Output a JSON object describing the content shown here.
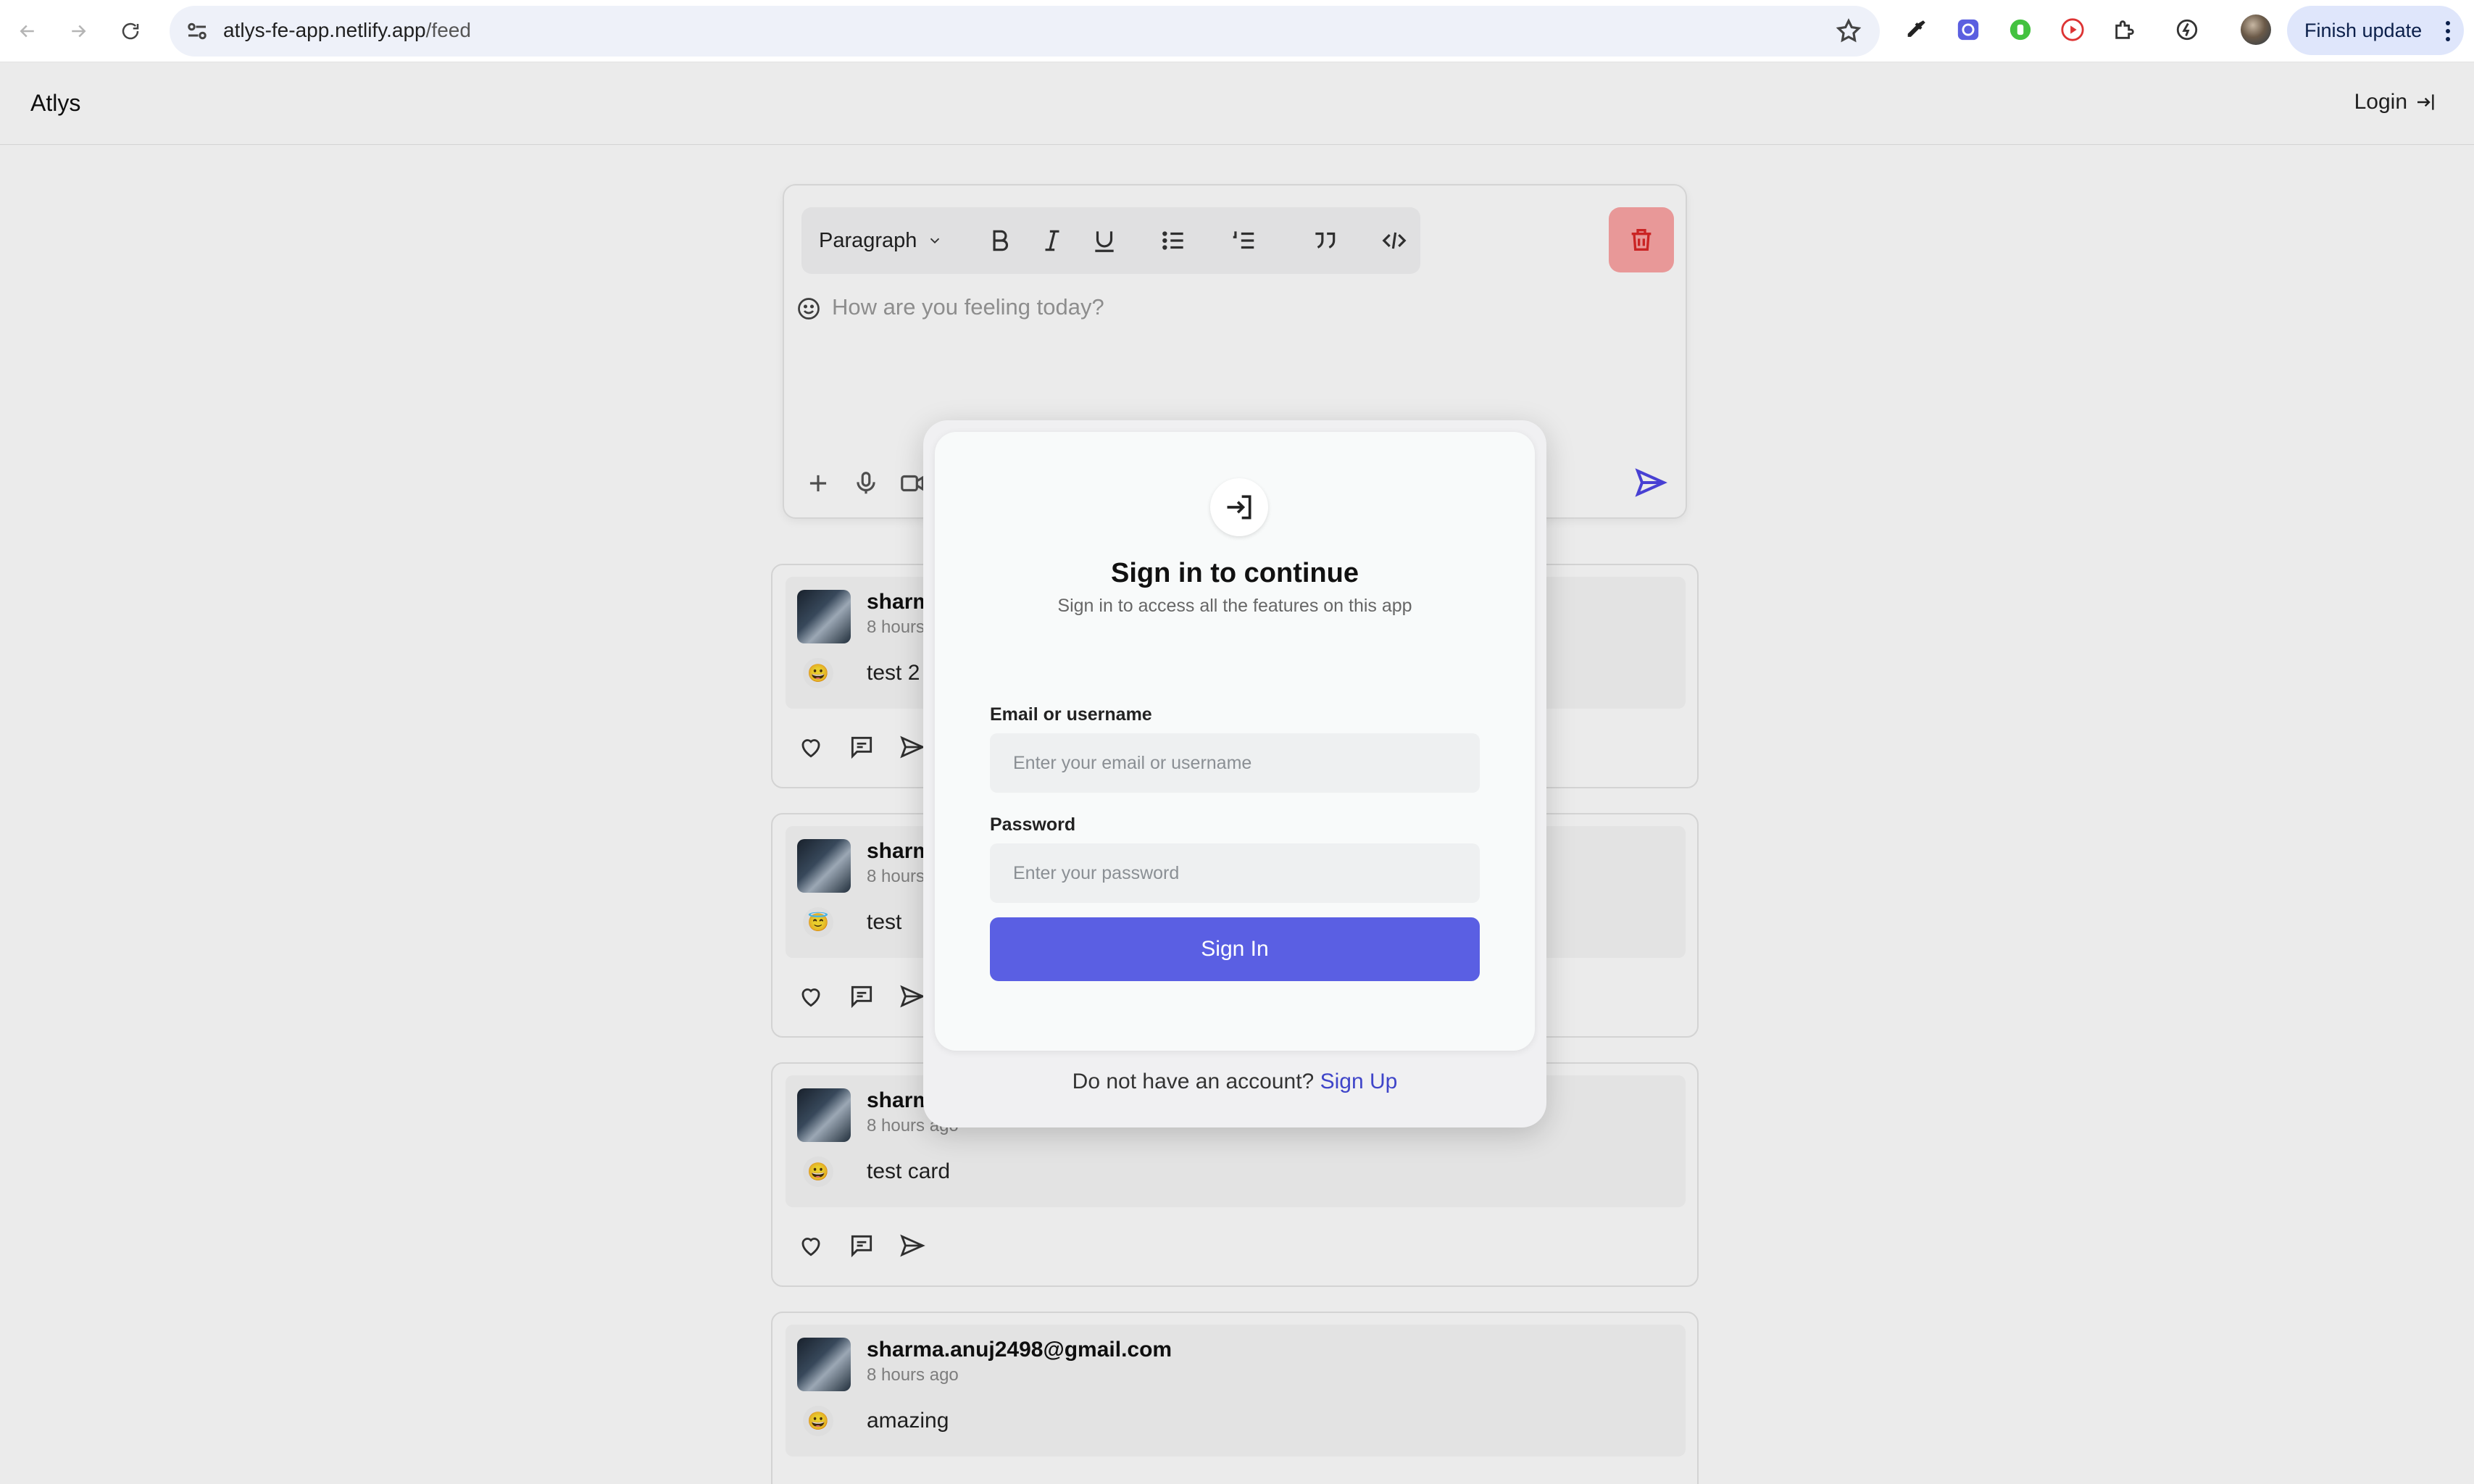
{
  "browser": {
    "url_host": "atlys-fe-app.netlify.app",
    "url_path": "/feed",
    "finish_update_label": "Finish update"
  },
  "app": {
    "brand": "Atlys",
    "login_label": "Login"
  },
  "composer": {
    "block_type": "Paragraph",
    "placeholder": "How are you feeling today?"
  },
  "posts": [
    {
      "author": "sharma.anuj2498@gmail.com",
      "time": "8 hours ago",
      "emoji": "😀",
      "text": "test 2"
    },
    {
      "author": "sharma.anuj2498@gmail.com",
      "time": "8 hours ago",
      "emoji": "😇",
      "text": "test"
    },
    {
      "author": "sharma.anuj2498@gmail.com",
      "time": "8 hours ago",
      "emoji": "😀",
      "text": "test card"
    },
    {
      "author": "sharma.anuj2498@gmail.com",
      "time": "8 hours ago",
      "emoji": "😀",
      "text": "amazing"
    }
  ],
  "modal": {
    "title": "Sign in to continue",
    "subtitle": "Sign in to access all the features on this app",
    "email_label": "Email or username",
    "email_placeholder": "Enter your email or username",
    "password_label": "Password",
    "password_placeholder": "Enter your password",
    "submit_label": "Sign In",
    "signup_prompt": "Do not have an account?",
    "signup_link": "Sign Up"
  },
  "colors": {
    "primary": "#5a5fe3",
    "link": "#3f45c9",
    "danger_soft": "#fca5a5"
  }
}
